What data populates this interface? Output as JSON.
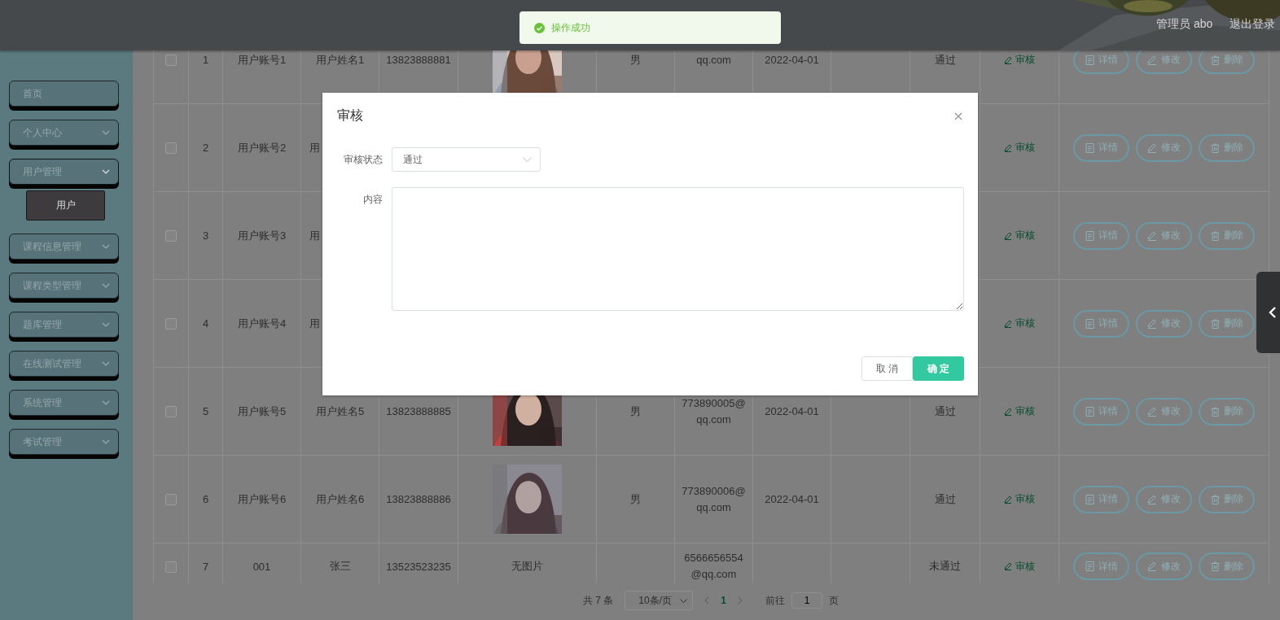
{
  "toast": {
    "text": "操作成功"
  },
  "header": {
    "user": "管理员 abo",
    "logout": "退出登录"
  },
  "sidebar": {
    "items": [
      {
        "label": "首页",
        "kind": "link"
      },
      {
        "label": "个人中心",
        "kind": "group",
        "expanded": false
      },
      {
        "label": "用户管理",
        "kind": "group",
        "expanded": true,
        "children": [
          {
            "label": "用户",
            "selected": true
          }
        ]
      },
      {
        "label": "课程信息管理",
        "kind": "group",
        "expanded": false
      },
      {
        "label": "课程类型管理",
        "kind": "group",
        "expanded": false
      },
      {
        "label": "题库管理",
        "kind": "group",
        "expanded": false
      },
      {
        "label": "在线测试管理",
        "kind": "group",
        "expanded": false
      },
      {
        "label": "系统管理",
        "kind": "group",
        "expanded": false
      },
      {
        "label": "考试管理",
        "kind": "group",
        "expanded": false
      }
    ]
  },
  "table": {
    "rows": [
      {
        "checked": false,
        "index": "1",
        "account": "用户账号1",
        "name": "用户姓名1",
        "phone": "13823888881",
        "gender": "男",
        "email": "qq.com",
        "date": "2022-04-01",
        "status": "通过",
        "review": "审核",
        "actions": [
          "详情",
          "修改",
          "删除"
        ]
      },
      {
        "checked": false,
        "index": "2",
        "account": "用户账号2",
        "name": "用",
        "review": "审核",
        "actions": [
          "详情",
          "修改",
          "删除"
        ]
      },
      {
        "checked": false,
        "index": "3",
        "account": "用户账号3",
        "name": "用",
        "review": "审核",
        "actions": [
          "详情",
          "修改",
          "删除"
        ]
      },
      {
        "checked": false,
        "index": "4",
        "account": "用户账号4",
        "name": "用",
        "review": "审核",
        "actions": [
          "详情",
          "修改",
          "删除"
        ]
      },
      {
        "checked": false,
        "index": "5",
        "account": "用户账号5",
        "name": "用户姓名5",
        "phone": "13823888885",
        "gender": "男",
        "email": "773890005@qq.com",
        "date": "2022-04-01",
        "status": "通过",
        "review": "审核",
        "actions": [
          "详情",
          "修改",
          "删除"
        ]
      },
      {
        "checked": false,
        "index": "6",
        "account": "用户账号6",
        "name": "用户姓名6",
        "phone": "13823888886",
        "gender": "男",
        "email": "773890006@qq.com",
        "date": "2022-04-01",
        "status": "通过",
        "review": "审核",
        "actions": [
          "详情",
          "修改",
          "删除"
        ]
      },
      {
        "checked": false,
        "index": "7",
        "account": "001",
        "name": "张三",
        "phone": "13523523235",
        "photo": {
          "kind": "text",
          "text": "无图片"
        },
        "email": "6566656554@qq.com",
        "status": "未通过",
        "review": "审核",
        "actions": [
          "详情",
          "修改",
          "删除"
        ]
      }
    ]
  },
  "pagination": {
    "total": "共 7 条",
    "page_size": "10条/页",
    "pages": [
      {
        "label": "1",
        "selected": true
      }
    ],
    "goto_label": "前往",
    "goto_value": "1",
    "goto_unit": "页"
  },
  "dialog": {
    "title": "审核",
    "fields": [
      {
        "kind": "select",
        "label": "审核状态",
        "value": "通过"
      },
      {
        "kind": "textarea",
        "label": "内容"
      }
    ],
    "buttons": [
      {
        "label": "取 消",
        "kind": "default"
      },
      {
        "label": "确 定",
        "kind": "primary"
      }
    ]
  }
}
